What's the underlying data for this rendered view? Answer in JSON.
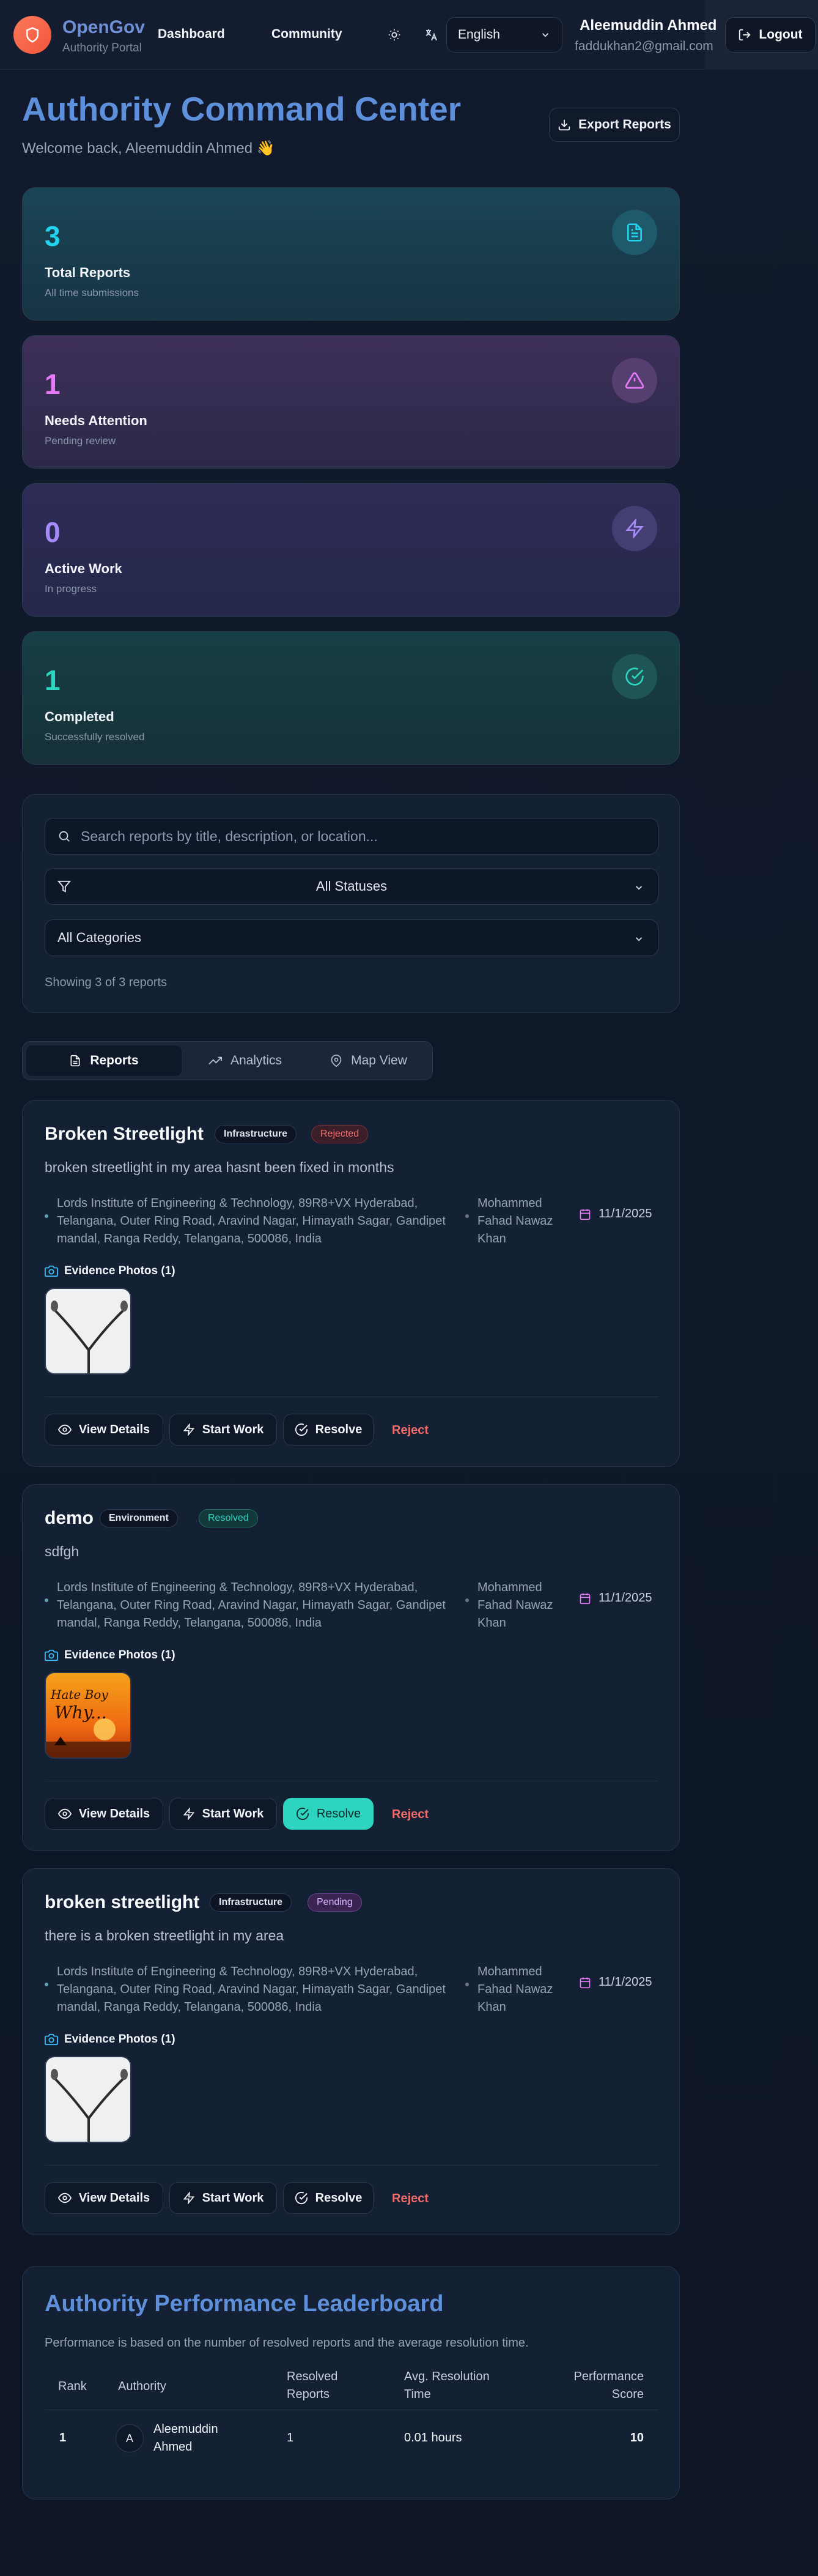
{
  "header": {
    "brand": "OpenGov",
    "brand_sub": "Authority Portal",
    "nav": [
      "Dashboard",
      "Community"
    ],
    "language": "English",
    "user_name": "Aleemuddin Ahmed",
    "user_email": "faddukhan2@gmail.com",
    "logout_label": "Logout"
  },
  "page": {
    "title": "Authority Command Center",
    "welcome": "Welcome back, Aleemuddin Ahmed 👋",
    "export_label": "Export Reports"
  },
  "stats": [
    {
      "value": "3",
      "label": "Total Reports",
      "sub": "All time submissions",
      "accent": "#22d3ee",
      "icon": "document-icon"
    },
    {
      "value": "1",
      "label": "Needs Attention",
      "sub": "Pending review",
      "accent": "#e879f9",
      "icon": "alert-triangle-icon"
    },
    {
      "value": "0",
      "label": "Active Work",
      "sub": "In progress",
      "accent": "#a78bfa",
      "icon": "lightning-icon"
    },
    {
      "value": "1",
      "label": "Completed",
      "sub": "Successfully resolved",
      "accent": "#2dd4bf",
      "icon": "check-circle-icon"
    }
  ],
  "filters": {
    "search_placeholder": "Search reports by title, description, or location...",
    "status": "All Statuses",
    "category": "All Categories",
    "showing": "Showing 3 of 3 reports"
  },
  "tabs": [
    "Reports",
    "Analytics",
    "Map View"
  ],
  "reports": [
    {
      "title": "Broken Streetlight",
      "category": "Infrastructure",
      "status": "Rejected",
      "description": "broken streetlight in my area hasnt been fixed in months",
      "location": "Lords Institute of Engineering & Technology, 89R8+VX Hyderabad, Telangana, Outer Ring Road, Aravind Nagar, Himayath Sagar, Gandipet mandal, Ranga Reddy, Telangana, 500086, India",
      "reporter": "Mohammed Fahad Nawaz Khan",
      "date": "11/1/2025",
      "evidence": "Evidence Photos (1)"
    },
    {
      "title": "demo",
      "category": "Environment",
      "status": "Resolved",
      "description": "sdfgh",
      "location": "Lords Institute of Engineering & Technology, 89R8+VX Hyderabad, Telangana, Outer Ring Road, Aravind Nagar, Himayath Sagar, Gandipet mandal, Ranga Reddy, Telangana, 500086, India",
      "reporter": "Mohammed Fahad Nawaz Khan",
      "date": "11/1/2025",
      "evidence": "Evidence Photos (1)",
      "photo_text": "Hate Boy Why..."
    },
    {
      "title": "broken streetlight",
      "category": "Infrastructure",
      "status": "Pending",
      "description": "there is a broken streetlight in my area",
      "location": "Lords Institute of Engineering & Technology, 89R8+VX Hyderabad, Telangana, Outer Ring Road, Aravind Nagar, Himayath Sagar, Gandipet mandal, Ranga Reddy, Telangana, 500086, India",
      "reporter": "Mohammed Fahad Nawaz Khan",
      "date": "11/1/2025",
      "evidence": "Evidence Photos (1)"
    }
  ],
  "actions": {
    "view": "View Details",
    "start": "Start Work",
    "resolve": "Resolve",
    "reject": "Reject"
  },
  "leaderboard": {
    "title": "Authority Performance Leaderboard",
    "description": "Performance is based on the number of resolved reports and the average resolution time.",
    "headers": [
      "Rank",
      "Authority",
      "Resolved Reports",
      "Avg. Resolution Time",
      "Performance Score"
    ],
    "rows": [
      {
        "rank": "1",
        "initial": "A",
        "authority": "Aleemuddin Ahmed",
        "resolved": "1",
        "avg_time": "0.01 hours",
        "score": "10"
      }
    ]
  },
  "colors": {
    "rejected": "#f87171",
    "resolved": "#2dd4bf",
    "pending": "#d8b4fe",
    "title_blue": "#5d8fdb"
  }
}
